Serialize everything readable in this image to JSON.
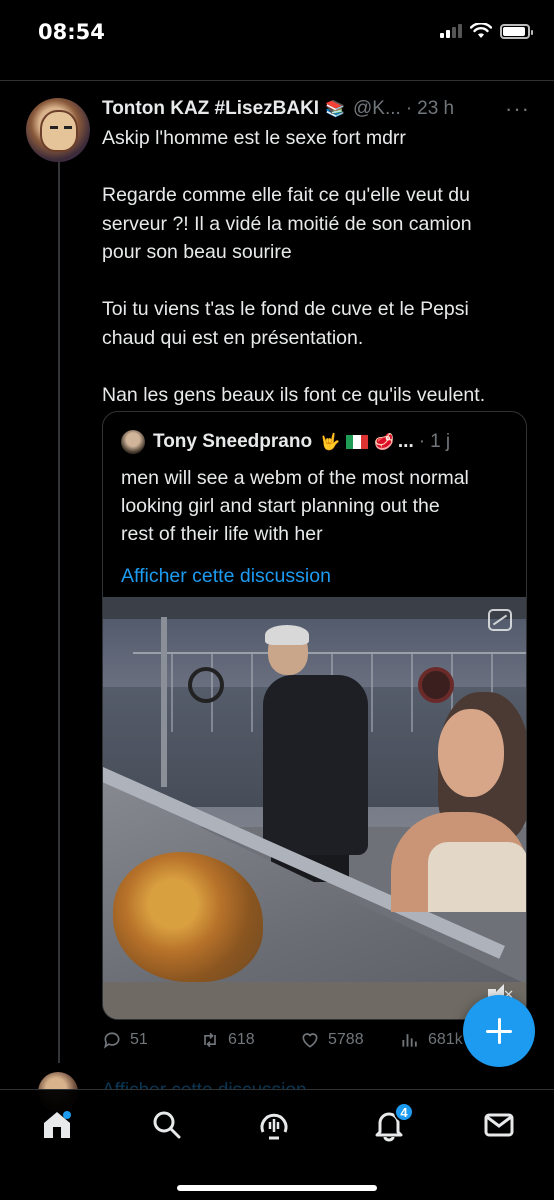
{
  "status_bar": {
    "time": "08:54"
  },
  "tweet": {
    "author_name": "Tonton KAZ #LisezBAKI",
    "author_emoji": "📚",
    "handle": "@K...",
    "separator": "·",
    "time": "23 h",
    "more_icon": "more-dots-icon",
    "text_lines": [
      "Askip l'homme est le sexe fort mdrr",
      "",
      "Regarde comme elle fait ce qu'elle veut du",
      "serveur ?! Il a vidé la moitié de son camion",
      "pour son beau sourire",
      "",
      "Toi tu viens t'as le fond de cuve et le Pepsi",
      "chaud qui est en présentation.",
      "",
      "Nan les gens beaux ils font ce qu'ils veulent."
    ]
  },
  "quote": {
    "author_name": "Tony Sneedprano",
    "emojis": [
      "🤟",
      "🇮🇹",
      "🥩"
    ],
    "ellipsis": "...",
    "separator": "·",
    "time": "1 j",
    "text_lines": [
      "men will see a webm of the most normal",
      "looking girl and start planning out the",
      "rest of their life with her"
    ],
    "show_thread": "Afficher cette discussion",
    "media_icons": [
      "gif-icon",
      "mute-icon"
    ]
  },
  "actions": {
    "replies": "51",
    "retweets": "618",
    "likes": "5788",
    "views": "681k"
  },
  "next_item": {
    "link_text": "Afficher cette discussion"
  },
  "tabbar": {
    "items": [
      "home-icon",
      "search-icon",
      "spaces-icon",
      "notifications-icon",
      "messages-icon"
    ],
    "notification_badge": "4"
  },
  "colors": {
    "accent": "#1d9bf0",
    "background": "#000000",
    "muted": "#71767b",
    "text": "#e7e9ea"
  }
}
